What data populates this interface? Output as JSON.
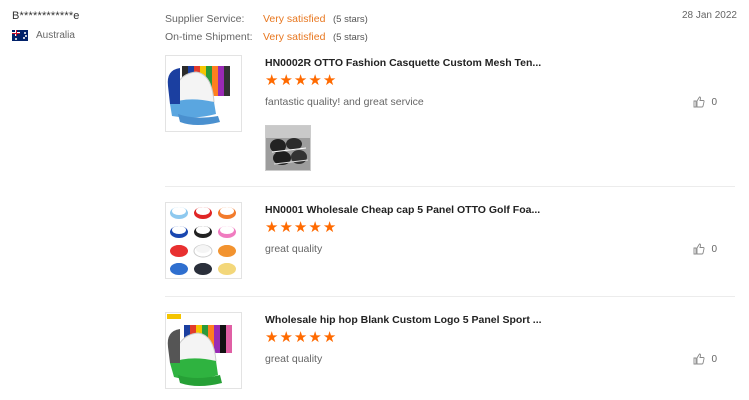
{
  "buyer": {
    "name": "B************e",
    "country": "Australia",
    "flag_icon": "australia-flag-icon"
  },
  "ratings": [
    {
      "label": "Supplier Service:",
      "value": "Very satisfied",
      "stars": "(5 stars)"
    },
    {
      "label": "On-time Shipment:",
      "value": "Very satisfied",
      "stars": "(5 stars)"
    }
  ],
  "date": "28 Jan 2022",
  "colors": {
    "accent": "#e8771f",
    "star": "#ff6a00"
  },
  "reviews": [
    {
      "title": "HN0002R OTTO Fashion Casquette Custom Mesh Ten...",
      "rating": 5,
      "comment": "fantastic quality! and great service",
      "likes": "0",
      "has_photo": true
    },
    {
      "title": "HN0001 Wholesale Cheap cap 5 Panel OTTO Golf Foa...",
      "rating": 5,
      "comment": "great quality",
      "likes": "0",
      "has_photo": false
    },
    {
      "title": "Wholesale hip hop Blank Custom Logo 5 Panel Sport ...",
      "rating": 5,
      "comment": "great quality",
      "likes": "0",
      "has_photo": false
    }
  ]
}
